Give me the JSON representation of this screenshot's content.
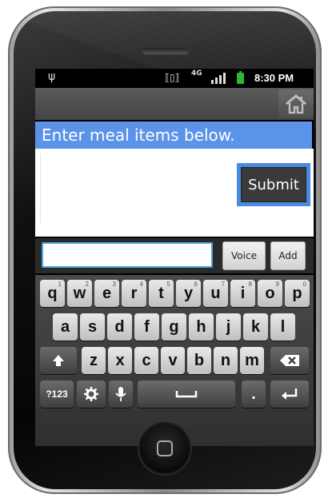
{
  "status_bar": {
    "network_type": "4G",
    "time": "8:30 PM",
    "battery_color": "#2fb52f",
    "usb_icon": "usb-icon",
    "vibrate_icon": "vibrate-icon",
    "signal_icon": "signal-bars-icon"
  },
  "title_bar": {
    "home_icon": "home-icon"
  },
  "header": {
    "text": "Enter meal items below.",
    "color": "#5b93e8"
  },
  "actions": {
    "submit_label": "Submit"
  },
  "input_row": {
    "meal_input_value": "",
    "meal_input_placeholder": "",
    "voice_label": "Voice",
    "add_label": "Add"
  },
  "keyboard": {
    "row1": [
      {
        "key": "q",
        "hint": "1"
      },
      {
        "key": "w",
        "hint": "2"
      },
      {
        "key": "e",
        "hint": "3"
      },
      {
        "key": "r",
        "hint": "4"
      },
      {
        "key": "t",
        "hint": "5"
      },
      {
        "key": "y",
        "hint": "6"
      },
      {
        "key": "u",
        "hint": "7"
      },
      {
        "key": "i",
        "hint": "8"
      },
      {
        "key": "o",
        "hint": "9"
      },
      {
        "key": "p",
        "hint": "0"
      }
    ],
    "row2": [
      "a",
      "s",
      "d",
      "f",
      "g",
      "h",
      "j",
      "k",
      "l"
    ],
    "row3": [
      "z",
      "x",
      "c",
      "v",
      "b",
      "n",
      "m"
    ],
    "shift_icon": "shift-arrow-icon",
    "delete_icon": "backspace-icon",
    "symbols_label": "?123",
    "settings_icon": "gear-icon",
    "mic_icon": "microphone-icon",
    "space_icon": "spacebar-icon",
    "period_label": ".",
    "enter_icon": "enter-icon"
  },
  "device": {
    "home_button_icon": "home-square-icon"
  }
}
